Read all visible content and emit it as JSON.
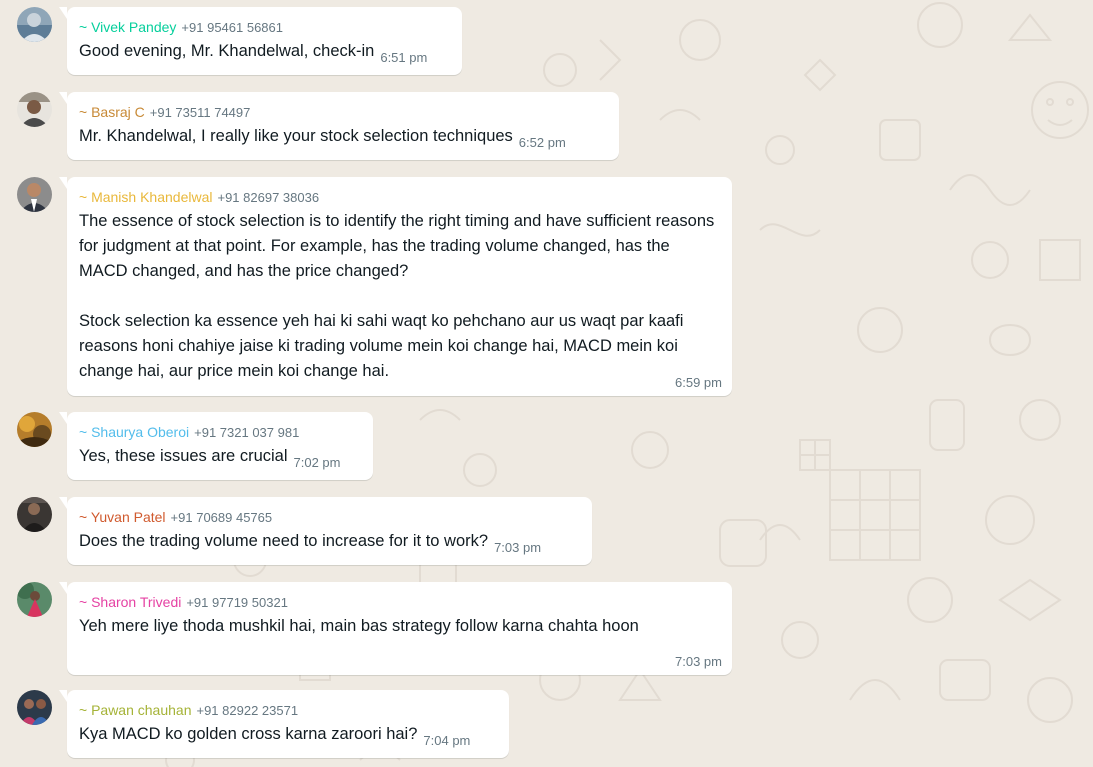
{
  "chat": {
    "messages": [
      {
        "sender": "~ Vivek Pandey",
        "phone": "+91 95461 56861",
        "text": "Good evening, Mr. Khandelwal, check-in",
        "time": "6:51 pm",
        "sender_color": "#06cf9c"
      },
      {
        "sender": "~ Basraj C",
        "phone": "+91 73511 74497",
        "text": "Mr. Khandelwal, I really like your stock selection techniques",
        "time": "6:52 pm",
        "sender_color": "#c88a37"
      },
      {
        "sender": "~ Manish Khandelwal",
        "phone": "+91 82697 38036",
        "text": "The essence of stock selection is to identify the right timing and have sufficient reasons for judgment at that point. For example, has the trading volume changed, has the MACD changed, and has the price changed?\n\nStock selection ka essence yeh hai ki sahi waqt ko pehchano aur us waqt par kaafi reasons honi chahiye jaise ki trading volume mein koi change hai, MACD mein koi change hai, aur price mein koi change hai.",
        "time": "6:59 pm",
        "sender_color": "#e9b83b"
      },
      {
        "sender": "~ Shaurya Oberoi",
        "phone": "+91 7321 037 981",
        "text": "Yes, these issues are crucial",
        "time": "7:02 pm",
        "sender_color": "#53bdeb"
      },
      {
        "sender": "~ Yuvan Patel",
        "phone": "+91 70689 45765",
        "text": "Does the trading volume need to increase for it to work?",
        "time": "7:03 pm",
        "sender_color": "#d05a2e"
      },
      {
        "sender": "~ Sharon Trivedi",
        "phone": "+91 97719 50321",
        "text": "Yeh mere liye thoda mushkil hai, main bas strategy follow karna chahta hoon",
        "time": "7:03 pm",
        "sender_color": "#e542a3"
      },
      {
        "sender": "~ Pawan chauhan",
        "phone": "+91 82922 23571",
        "text": "Kya MACD ko golden cross karna zaroori hai?",
        "time": "7:04 pm",
        "sender_color": "#a5b337"
      }
    ]
  }
}
